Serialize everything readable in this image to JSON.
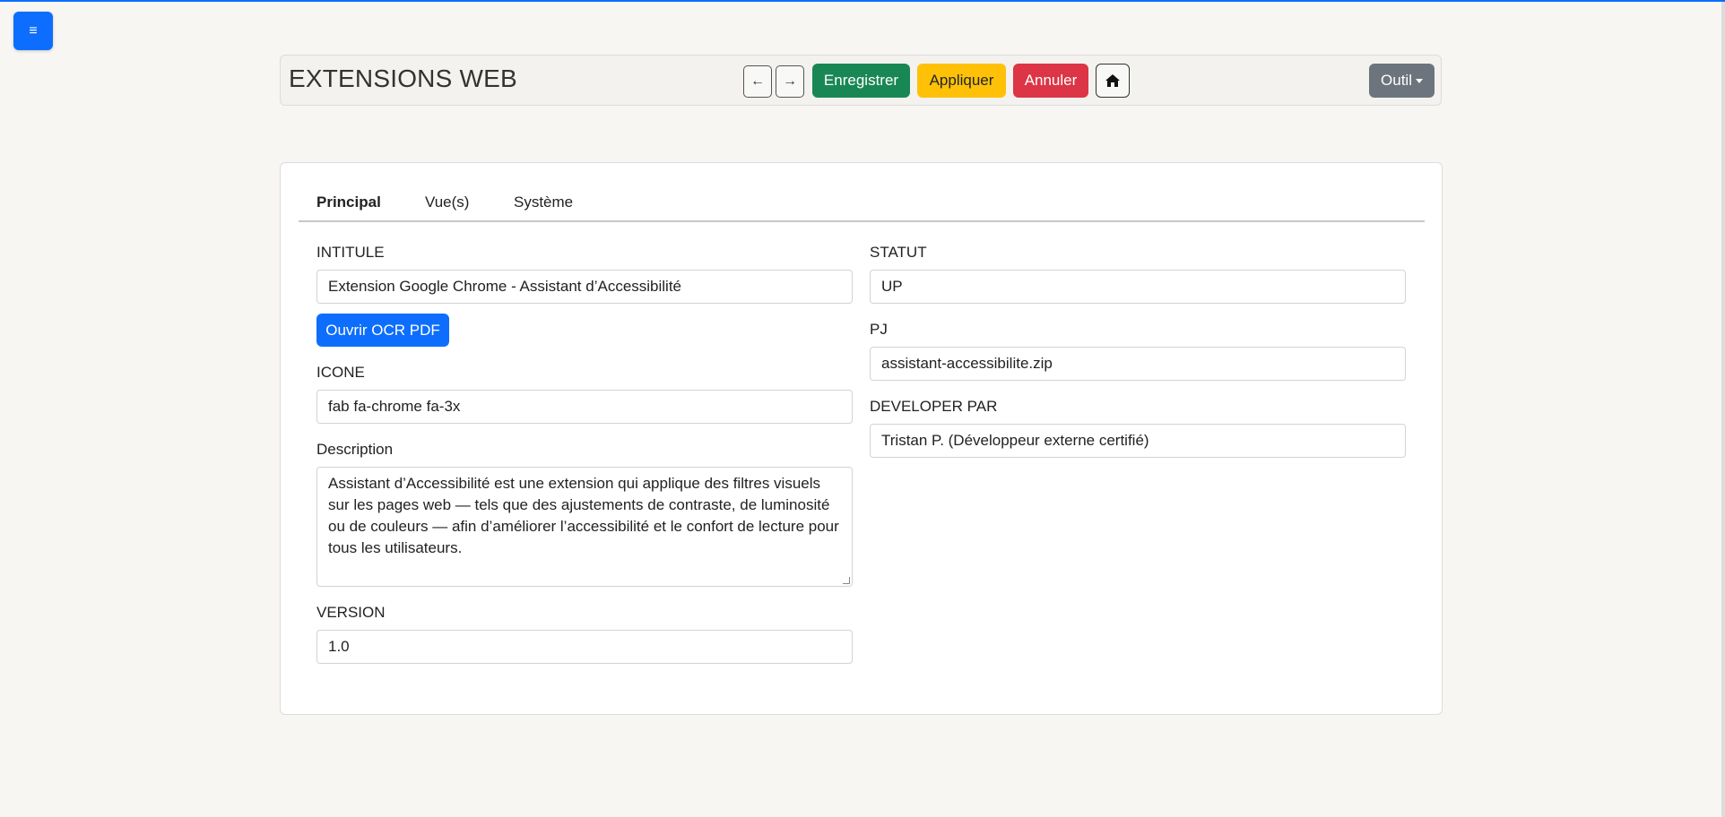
{
  "menu": {
    "icon_glyph": "≡"
  },
  "header": {
    "title": "EXTENSIONS WEB",
    "back_glyph": "←",
    "forward_glyph": "→",
    "save_label": "Enregistrer",
    "apply_label": "Appliquer",
    "cancel_label": "Annuler",
    "tools_label": "Outil"
  },
  "tabs": [
    {
      "label": "Principal",
      "active": true
    },
    {
      "label": "Vue(s)",
      "active": false
    },
    {
      "label": "Système",
      "active": false
    }
  ],
  "form": {
    "intitule": {
      "label": "INTITULE",
      "value": "Extension Google Chrome - Assistant d’Accessibilité"
    },
    "ocr_button_label": "Ouvrir OCR PDF",
    "icone": {
      "label": "ICONE",
      "value": "fab fa-chrome fa-3x"
    },
    "description": {
      "label": "Description",
      "value": "Assistant d’Accessibilité est une extension qui applique des filtres visuels sur les pages web — tels que des ajustements de contraste, de luminosité ou de couleurs — afin d’améliorer l’accessibilité et le confort de lecture pour tous les utilisateurs."
    },
    "version": {
      "label": "VERSION",
      "value": "1.0"
    },
    "statut": {
      "label": "STATUT",
      "value": "UP"
    },
    "pj": {
      "label": "PJ",
      "value": "assistant-accessibilite.zip"
    },
    "developer": {
      "label": "DEVELOPER PAR",
      "value": "Tristan P. (Développeur externe certifié)"
    }
  },
  "colors": {
    "primary": "#0d6efd",
    "success": "#198754",
    "warning": "#ffc107",
    "danger": "#dc3545",
    "secondary": "#6c757d"
  }
}
